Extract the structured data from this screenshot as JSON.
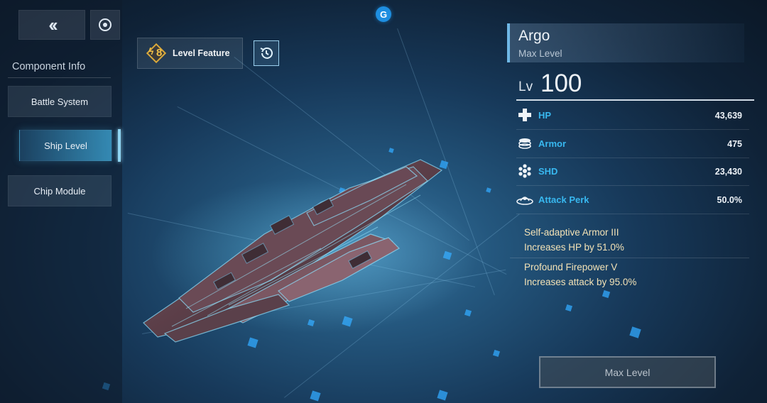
{
  "top_bar": {
    "back_icon": "double-chevron-left-icon",
    "cycle_icon": "circle-target-icon",
    "currency_badge": "G"
  },
  "sidebar": {
    "title": "Component Info",
    "items": [
      {
        "label": "Battle System",
        "active": false
      },
      {
        "label": "Ship Level",
        "active": true
      },
      {
        "label": "Chip Module",
        "active": false
      }
    ]
  },
  "level_feature": {
    "count": "8",
    "label": "Level Feature",
    "history_icon": "history-icon"
  },
  "ship": {
    "name": "Argo",
    "subtitle": "Max Level",
    "level_prefix": "Lv",
    "level": "100"
  },
  "stats": [
    {
      "name": "HP",
      "value": "43,639",
      "icon": "hp-cross-icon"
    },
    {
      "name": "Armor",
      "value": "475",
      "icon": "armor-stack-icon"
    },
    {
      "name": "SHD",
      "value": "23,430",
      "icon": "shield-hex-icon"
    },
    {
      "name": "Attack Perk",
      "value": "50.0%",
      "icon": "attack-perk-icon"
    }
  ],
  "perks": [
    {
      "title": "Self-adaptive Armor III",
      "desc": "Increases HP by 51.0%"
    },
    {
      "title": "Profound Firepower V",
      "desc": "Increases attack by 95.0%"
    }
  ],
  "max_level_button": "Max Level",
  "colors": {
    "accent_blue": "#38b8f0",
    "perk_text": "#f3e2b6",
    "feature_gold": "#f2c048"
  }
}
